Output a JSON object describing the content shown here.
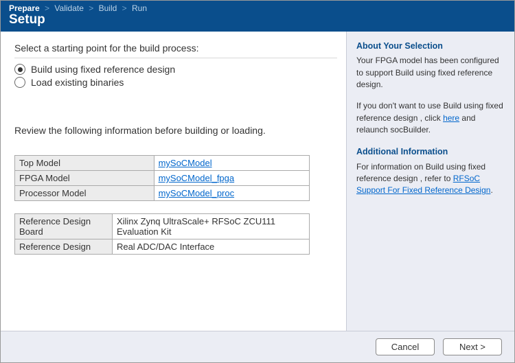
{
  "breadcrumbs": {
    "items": [
      "Prepare",
      "Validate",
      "Build",
      "Run"
    ],
    "current_index": 0
  },
  "page_title": "Setup",
  "starting_point": {
    "prompt": "Select a starting point for the build process:",
    "options": [
      {
        "label": "Build using fixed reference design",
        "selected": true
      },
      {
        "label": "Load existing binaries",
        "selected": false
      }
    ]
  },
  "review_label": "Review the following information before building or loading.",
  "model_table": {
    "rows": [
      {
        "key": "Top Model",
        "value": "mySoCModel",
        "link": true
      },
      {
        "key": "FPGA Model",
        "value": "mySoCModel_fpga",
        "link": true
      },
      {
        "key": "Processor Model",
        "value": "mySoCModel_proc",
        "link": true
      }
    ]
  },
  "design_table": {
    "rows": [
      {
        "key": "Reference Design Board",
        "value": "Xilinx Zynq UltraScale+ RFSoC ZCU111 Evaluation Kit"
      },
      {
        "key": "Reference Design",
        "value": "Real ADC/DAC Interface"
      }
    ]
  },
  "sidebar": {
    "about_heading": "About Your Selection",
    "about_text": "Your FPGA model has been configured to support Build using fixed reference design.",
    "alt_text_pre": "If you don't want to use Build using fixed reference design , click  ",
    "alt_link": "here",
    "alt_text_post": " and relaunch socBuilder.",
    "info_heading": "Additional Information",
    "info_text_pre": "For information on Build using fixed reference design , refer to ",
    "info_link": "RFSoC Support For Fixed Reference Design",
    "info_text_post": "."
  },
  "footer": {
    "cancel_label": "Cancel",
    "next_label": "Next >"
  }
}
